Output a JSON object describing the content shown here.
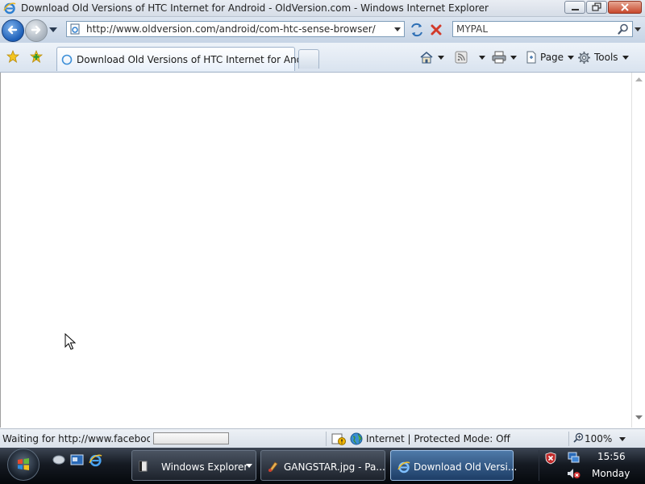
{
  "window": {
    "title": "Download Old Versions of HTC Internet for Android - OldVersion.com - Windows Internet Explorer"
  },
  "toolbar": {
    "url": "http://www.oldversion.com/android/com-htc-sense-browser/",
    "search_value": "MYPAL"
  },
  "tabs": [
    {
      "label": "Download Old Versions of HTC Internet for Andr..."
    }
  ],
  "commands": {
    "page_label": "Page",
    "tools_label": "Tools"
  },
  "status": {
    "text": "Waiting for http://www.facebook.c",
    "zone": "Internet | Protected Mode: Off",
    "zoom": "100%"
  },
  "taskbar": {
    "items": [
      {
        "label": "Windows Explorer"
      },
      {
        "label": "GANGSTAR.jpg - Pa..."
      },
      {
        "label": "Download Old Versi..."
      }
    ],
    "clock_time": "15:56",
    "clock_day": "Monday"
  },
  "colors": {
    "ie_blue": "#1d5fb8",
    "taskbar_dark": "#151a22",
    "active_task": "#4e79a8",
    "close_red": "#c8482c"
  }
}
